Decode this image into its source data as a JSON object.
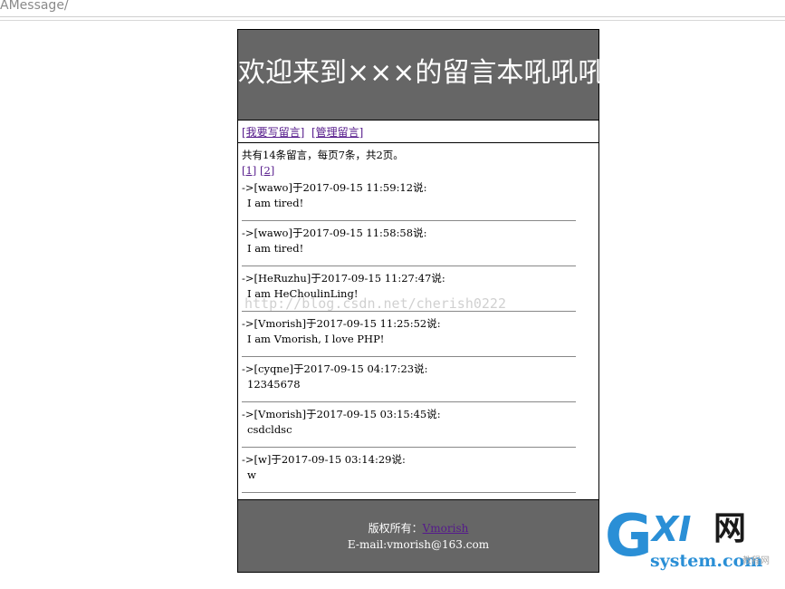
{
  "browser": {
    "address_text": "AMessage/"
  },
  "header": {
    "title": "欢迎来到×××的留言本吼吼吼",
    "background": "#666666"
  },
  "nav": {
    "write_label": "[我要写留言]",
    "manage_label": "[管理留言]"
  },
  "summary": {
    "text": "共有14条留言，每页7条，共2页。"
  },
  "pager": {
    "pages": [
      "[1]",
      "[2]"
    ]
  },
  "messages": [
    {
      "head": "->[wawo]于2017-09-15 11:59:12说:",
      "body": "I am tired!"
    },
    {
      "head": "->[wawo]于2017-09-15 11:58:58说:",
      "body": "I am tired!"
    },
    {
      "head": "->[HeRuzhu]于2017-09-15 11:27:47说:",
      "body": "I am HeChoulinLing!"
    },
    {
      "head": "->[Vmorish]于2017-09-15 11:25:52说:",
      "body": "I am Vmorish, I love PHP!"
    },
    {
      "head": "->[cyqne]于2017-09-15 04:17:23说:",
      "body": "12345678"
    },
    {
      "head": "->[Vmorish]于2017-09-15 03:15:45说:",
      "body": "csdcldsc"
    },
    {
      "head": "->[w]于2017-09-15 03:14:29说:",
      "body": "w"
    }
  ],
  "footer": {
    "copyright_prefix": "版权所有：",
    "copyright_link": "Vmorish",
    "email": "E-mail:vmorish@163.com"
  },
  "watermark": {
    "text": "http://blog.csdn.net/cherish0222"
  },
  "logo": {
    "g": "G",
    "xi": "XI",
    "wang": "网",
    "domain": "system.com",
    "tagline": "教程网"
  }
}
